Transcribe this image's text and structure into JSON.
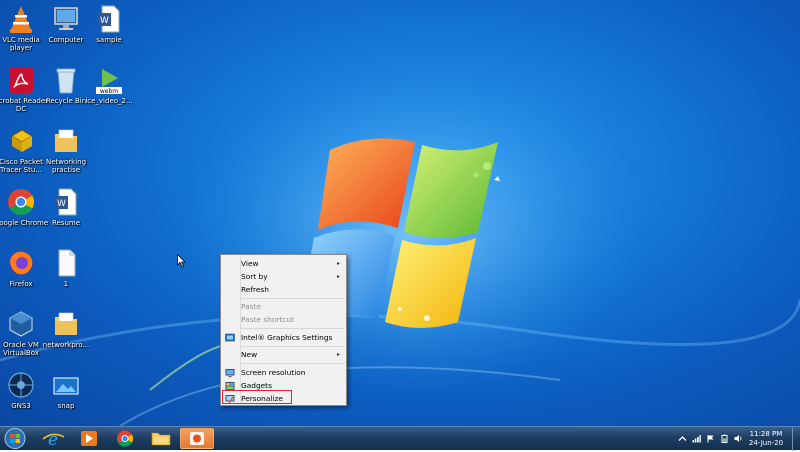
{
  "desktop_icons": [
    {
      "label": "VLC media player",
      "icon": "vlc-icon"
    },
    {
      "label": "Computer",
      "icon": "computer-icon"
    },
    {
      "label": "sample",
      "icon": "word-document-icon"
    },
    {
      "label": "Acrobat Reader DC",
      "icon": "acrobat-icon"
    },
    {
      "label": "Recycle Bin",
      "icon": "recycle-bin-icon"
    },
    {
      "label": "ice_video_2...",
      "icon": "webm-video-icon"
    },
    {
      "label": "Cisco Packet Tracer Stu...",
      "icon": "packet-tracer-icon"
    },
    {
      "label": "Networking practise",
      "icon": "folder-icon"
    },
    {
      "label": "Google Chrome",
      "icon": "chrome-icon"
    },
    {
      "label": "Resume",
      "icon": "word-document-icon"
    },
    {
      "label": "Firefox",
      "icon": "firefox-icon"
    },
    {
      "label": "1",
      "icon": "blank-file-icon"
    },
    {
      "label": "Oracle VM VirtualBox",
      "icon": "virtualbox-icon"
    },
    {
      "label": "networkpro...",
      "icon": "folder-icon"
    },
    {
      "label": "GNS3",
      "icon": "gns3-icon"
    },
    {
      "label": "snap",
      "icon": "image-file-icon"
    }
  ],
  "context_menu": {
    "view": "View",
    "sort_by": "Sort by",
    "refresh": "Refresh",
    "paste": "Paste",
    "paste_shortcut": "Paste shortcut",
    "intel": "Intel® Graphics Settings",
    "new": "New",
    "screen_resolution": "Screen resolution",
    "gadgets": "Gadgets",
    "personalize": "Personalize",
    "submenu_arrow": "▸",
    "highlight_color": "#e2262a"
  },
  "taskbar": {
    "pinned": [
      "internet-explorer-icon",
      "media-player-icon",
      "chrome-icon",
      "explorer-icon",
      "recording-app-icon"
    ],
    "clock_time": "11:28 PM",
    "clock_date": "24-Jun-20"
  }
}
